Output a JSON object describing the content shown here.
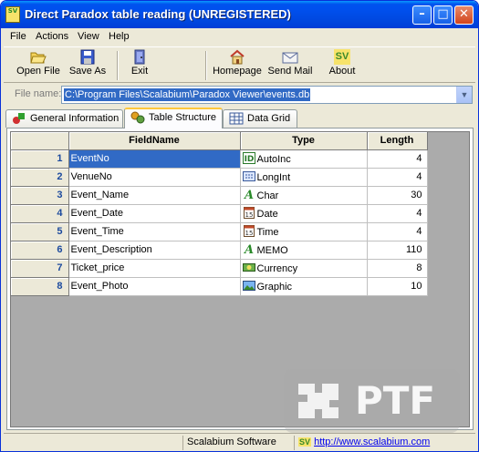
{
  "window": {
    "title": "Direct Paradox table reading (UNREGISTERED)",
    "app_icon_text": "SV"
  },
  "menu": [
    "File",
    "Actions",
    "View",
    "Help"
  ],
  "toolbar": {
    "open": "Open File",
    "save": "Save As",
    "exit": "Exit",
    "homepage": "Homepage",
    "sendmail": "Send Mail",
    "about": "About"
  },
  "file": {
    "label": "File name:",
    "value": "C:\\Program Files\\Scalabium\\Paradox Viewer\\events.db"
  },
  "tabs": [
    "General Information",
    "Table Structure",
    "Data Grid"
  ],
  "grid": {
    "columns": [
      "FieldName",
      "Type",
      "Length"
    ],
    "rows": [
      {
        "num": "1",
        "name": "EventNo",
        "type": "AutoInc",
        "length": "4",
        "icon": "id-icon"
      },
      {
        "num": "2",
        "name": "VenueNo",
        "type": "LongInt",
        "length": "4",
        "icon": "number-icon"
      },
      {
        "num": "3",
        "name": "Event_Name",
        "type": "Char",
        "length": "30",
        "icon": "text-a-icon"
      },
      {
        "num": "4",
        "name": "Event_Date",
        "type": "Date",
        "length": "4",
        "icon": "calendar-icon"
      },
      {
        "num": "5",
        "name": "Event_Time",
        "type": "Time",
        "length": "4",
        "icon": "calendar-icon"
      },
      {
        "num": "6",
        "name": "Event_Description",
        "type": "MEMO",
        "length": "110",
        "icon": "text-a-icon"
      },
      {
        "num": "7",
        "name": "Ticket_price",
        "type": "Currency",
        "length": "8",
        "icon": "currency-icon"
      },
      {
        "num": "8",
        "name": "Event_Photo",
        "type": "Graphic",
        "length": "10",
        "icon": "picture-icon"
      }
    ]
  },
  "watermark": "PTF",
  "status": {
    "company": "Scalabium Software",
    "link_icon": "SV",
    "link": "http://www.scalabium.com"
  }
}
